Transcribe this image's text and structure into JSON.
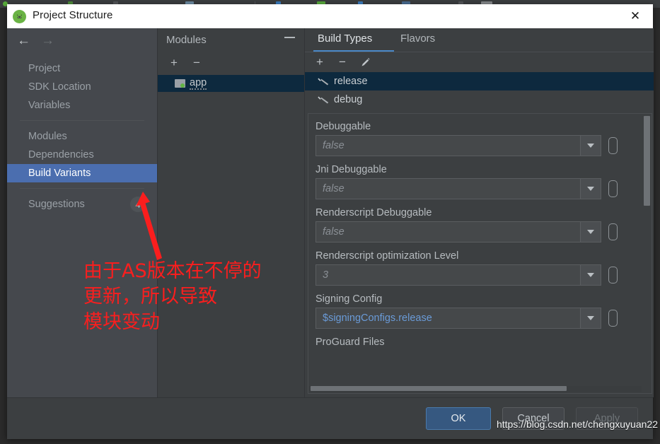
{
  "window": {
    "title": "Project Structure",
    "app_icon": "android-studio-icon",
    "close_label": "✕"
  },
  "nav": {
    "back_icon": "←",
    "forward_icon": "→",
    "groups": [
      {
        "items": [
          {
            "label": "Project",
            "selected": false
          },
          {
            "label": "SDK Location",
            "selected": false
          },
          {
            "label": "Variables",
            "selected": false
          }
        ]
      },
      {
        "items": [
          {
            "label": "Modules",
            "selected": false
          },
          {
            "label": "Dependencies",
            "selected": false
          },
          {
            "label": "Build Variants",
            "selected": true
          }
        ]
      },
      {
        "items": [
          {
            "label": "Suggestions",
            "selected": false,
            "badge": "4"
          }
        ]
      }
    ]
  },
  "modules": {
    "title": "Modules",
    "collapse_label": "−",
    "add_label": "+",
    "remove_label": "−",
    "items": [
      {
        "label": "app",
        "icon": "folder-module-icon",
        "selected": true
      }
    ]
  },
  "right_panel": {
    "tabs": [
      {
        "label": "Build Types",
        "active": true
      },
      {
        "label": "Flavors",
        "active": false
      }
    ],
    "toolbar": {
      "add_label": "+",
      "remove_label": "−",
      "edit_label": "✎"
    },
    "build_types": [
      {
        "label": "release",
        "selected": true
      },
      {
        "label": "debug",
        "selected": false
      }
    ],
    "fields": [
      {
        "label": "Debuggable",
        "value": "false",
        "style": "italic"
      },
      {
        "label": "Jni Debuggable",
        "value": "false",
        "style": "italic"
      },
      {
        "label": "Renderscript Debuggable",
        "value": "false",
        "style": "italic"
      },
      {
        "label": "Renderscript optimization Level",
        "value": "3",
        "style": "italic"
      },
      {
        "label": "Signing Config",
        "value": "$signingConfigs.release",
        "style": "link"
      }
    ],
    "partial_field_label": "ProGuard Files"
  },
  "buttons": {
    "ok": "OK",
    "cancel": "Cancel",
    "apply": "Apply"
  },
  "annotation": {
    "text": "由于AS版本在不停的\n更新，所以导致\n模块变动",
    "color": "#fa1e1e",
    "arrow": "red-arrow-pointing-to-build-variants"
  },
  "watermark": "https://blog.csdn.net/chengxuyuan22",
  "colors": {
    "accent_blue": "#4b6eaf",
    "tab_underline": "#4a88c7",
    "selection_dark": "#0d293e",
    "link_blue": "#6a9bd8",
    "annotation_red": "#fa1e1e"
  }
}
